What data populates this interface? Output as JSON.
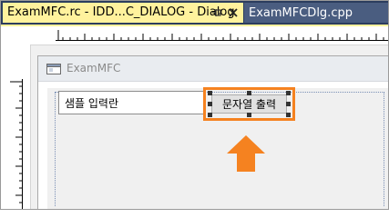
{
  "tabs": [
    {
      "label": "ExamMFC.rc - IDD...C_DIALOG - Dialog",
      "active": true
    },
    {
      "label": "ExamMFCDlg.cpp",
      "active": false
    }
  ],
  "dialog": {
    "title": "ExamMFC",
    "input_value": "샘플 입력란",
    "button_label": "문자열 출력"
  },
  "colors": {
    "highlight": "#f58220",
    "active_tab": "#fff29d",
    "tab_strip": "#2b3d5e"
  },
  "icons": [
    "pin-icon",
    "close-icon",
    "app-icon",
    "arrow-up-icon"
  ]
}
